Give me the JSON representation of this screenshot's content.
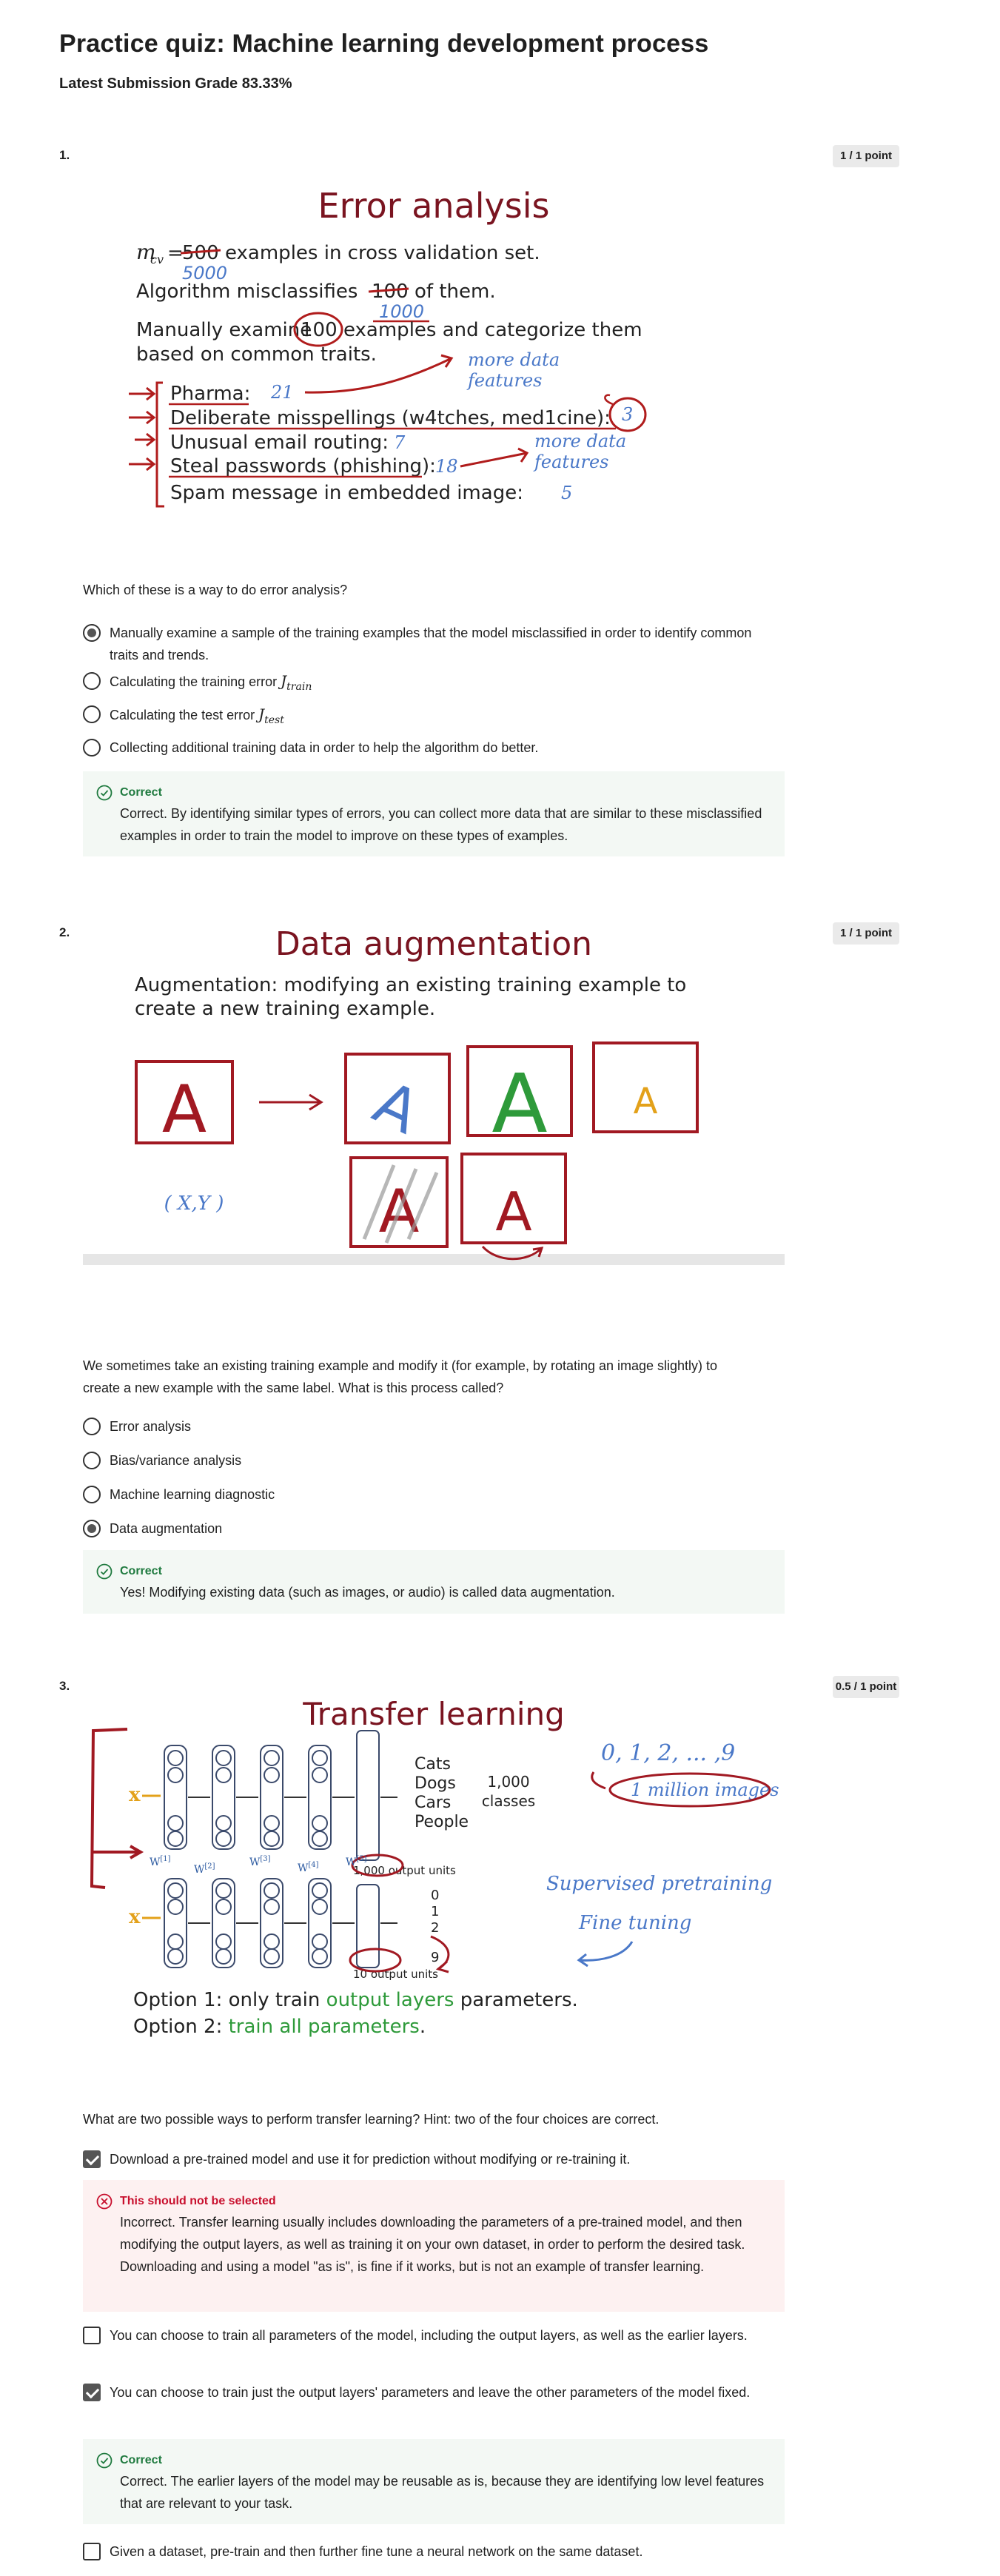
{
  "page": {
    "title": "Practice quiz: Machine learning development process",
    "grade_label": "Latest Submission Grade",
    "grade_value": "83.33%"
  },
  "q1": {
    "number": "1.",
    "points": "1 / 1 point",
    "figure": {
      "title": "Error analysis",
      "m_cv_label": "m",
      "m_cv_sub": "cv",
      "m_cv_old": "500",
      "m_cv_new": "5000",
      "line1_rest": "examples in cross validation set.",
      "line2_a": "Algorithm misclassifies",
      "line2_old": "100",
      "line2_new": "1000",
      "line2_b": "of them.",
      "line3_a": "Manually examine",
      "line3_num": "100",
      "line3_b": "examples and categorize them",
      "line4": "based on common traits.",
      "more_data_1": "more data",
      "features_1": "features",
      "cat1": "Pharma:",
      "cat1_n": "21",
      "cat2": "Deliberate misspellings (w4tches, med1cine):",
      "cat2_n": "3",
      "cat3": "Unusual email routing:",
      "cat3_n": "7",
      "cat4": "Steal passwords (phishing):",
      "cat4_n": "18",
      "cat5": "Spam message in embedded image:",
      "cat5_n": "5",
      "more_data_2": "more data",
      "features_2": "features"
    },
    "prompt": "Which of these is a way to do error analysis?",
    "options": [
      "Manually examine a sample of the training examples that the model misclassified in order to identify common traits and trends.",
      "Calculating the training error",
      "Calculating the test error",
      "Collecting additional training data in order to help the algorithm do better."
    ],
    "opt2_math": "J",
    "opt2_sub": "train",
    "opt3_math": "J",
    "opt3_sub": "test",
    "feedback_head": "Correct",
    "feedback_body": "Correct. By identifying similar types of errors, you can collect more data that are similar to these misclassified examples in order to train the model to improve on these types of examples."
  },
  "q2": {
    "number": "2.",
    "points": "1 / 1 point",
    "figure": {
      "title": "Data augmentation",
      "line1": "Augmentation: modifying an existing training example to",
      "line2": "create a new training example.",
      "letter": "A",
      "xy": "( X,Y )"
    },
    "prompt": "We sometimes take an existing training example and modify it (for example, by rotating an image slightly) to create a new example with the same label. What is this process called?",
    "options": [
      "Error analysis",
      "Bias/variance analysis",
      "Machine learning diagnostic",
      "Data augmentation"
    ],
    "feedback_head": "Correct",
    "feedback_body": "Yes! Modifying existing data (such as images, or audio) is called data augmentation."
  },
  "q3": {
    "number": "3.",
    "points": "0.5 / 1 point",
    "figure": {
      "title": "Transfer learning",
      "cats": "Cats",
      "dogs": "Dogs",
      "cars": "Cars",
      "people": "People",
      "count": "1,000",
      "classes": "classes",
      "units_top": "1,000 output units",
      "units_bottom": "10 output units",
      "digits": "0, 1, 2, ... ,9",
      "million": "1 million images",
      "pretrain": "Supervised pretraining",
      "finetune": "Fine tuning",
      "d0": "0",
      "d1": "1",
      "d2": "2",
      "d9": "9",
      "opt1_a": "Option 1: only train",
      "opt1_b": "output layers",
      "opt1_c": "parameters.",
      "opt2_a": "Option 2:",
      "opt2_b": "train all parameters",
      "opt2_c": ".",
      "x": "x",
      "w1": "W",
      "w_labels": [
        "[1]",
        "[2]",
        "[3]",
        "[4]",
        "[5]"
      ]
    },
    "prompt": "What are two possible ways to perform transfer learning? Hint: two of the four choices are correct.",
    "options": [
      "Download a pre-trained model and use it for prediction without modifying or re-training it.",
      "You can choose to train all parameters of the model, including the output layers, as well as the earlier layers.",
      "You can choose to train just the output layers' parameters and leave the other parameters of the model fixed.",
      "Given a dataset, pre-train and then further fine tune a neural network on the same dataset."
    ],
    "feedback1_head": "This should not be selected",
    "feedback1_body": "Incorrect. Transfer learning usually includes downloading the parameters of a pre-trained model, and then modifying the output layers, as well as training it on your own dataset, in order to perform the desired task. Downloading and using a model \"as is\", is fine if it works, but is not an example of transfer learning.",
    "feedback2_head": "Correct",
    "feedback2_body": "Correct. The earlier layers of the model may be reusable as is, because they are identifying low level features that are relevant to your task."
  },
  "colors": {
    "maroon": "#7a1420",
    "red_ink": "#b01c1c",
    "blue_ink": "#4a78c8",
    "green": "#2e9a3a",
    "orange": "#e3a11a",
    "correct_green": "#1f7a3f",
    "incorrect_red": "#c8102e"
  }
}
